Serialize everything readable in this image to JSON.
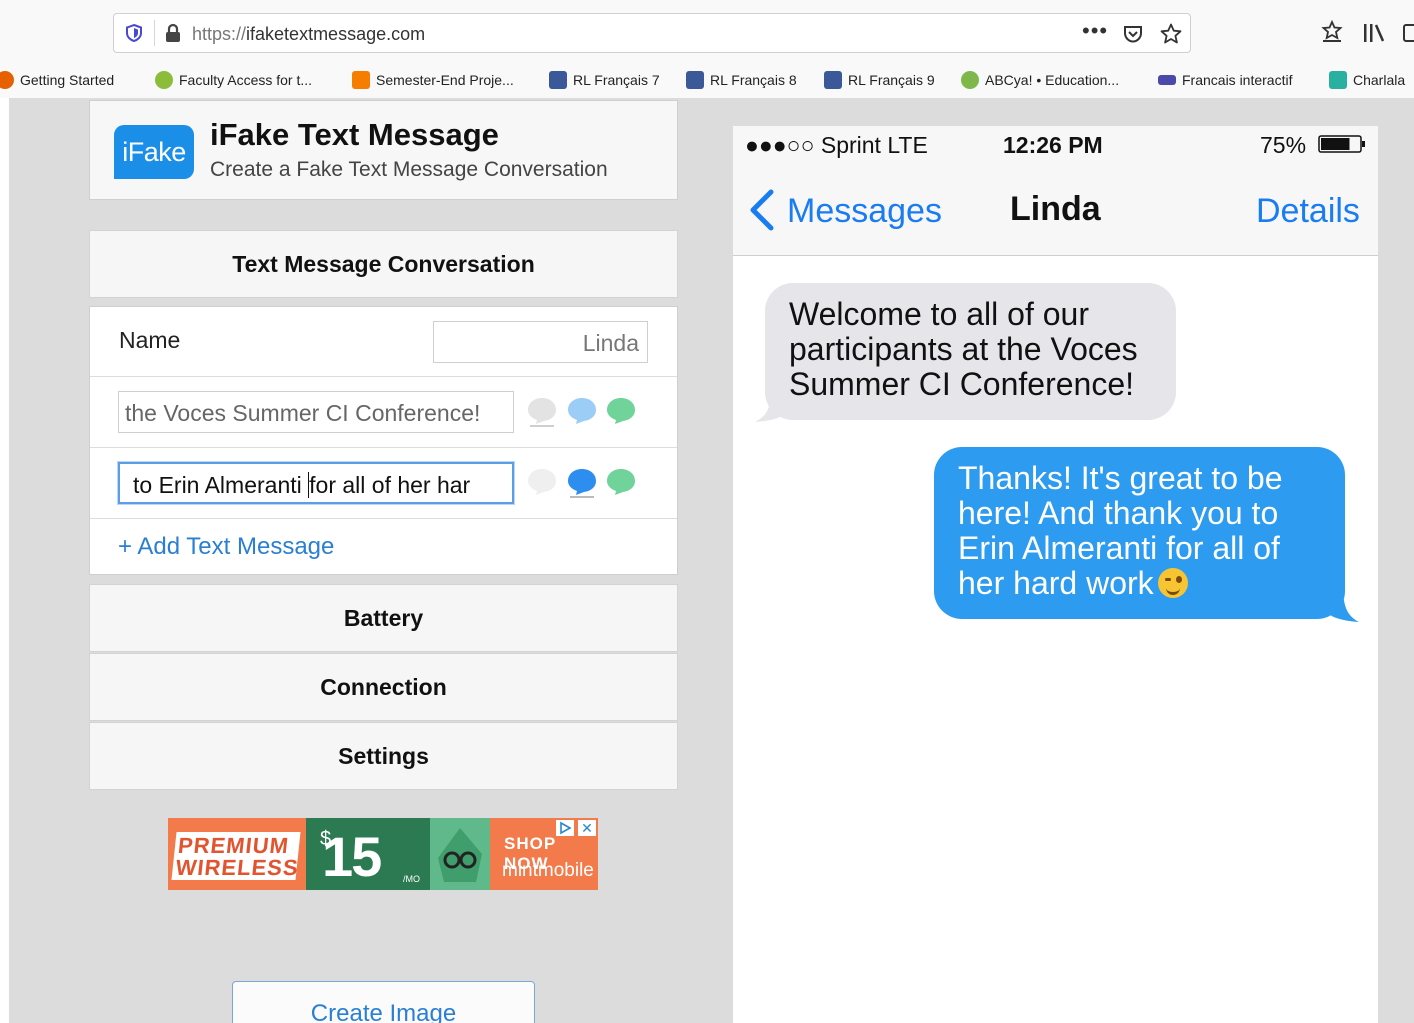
{
  "browser": {
    "url_prefix": "https://",
    "url_host": "ifaketextmessage.com",
    "more_label": "•••",
    "bookmarks": [
      {
        "label": "Getting Started",
        "icon": "firefox-icon",
        "color": "#e66000"
      },
      {
        "label": "Faculty Access for t...",
        "icon": "apple-icon",
        "color": "#8bbd3a"
      },
      {
        "label": "Semester-End Proje...",
        "icon": "blogger-icon",
        "color": "#f57d00"
      },
      {
        "label": "RL Français 7",
        "icon": "classroom-icon",
        "color": "#3b5998"
      },
      {
        "label": "RL Français 8",
        "icon": "classroom-icon",
        "color": "#3b5998"
      },
      {
        "label": "RL Français 9",
        "icon": "classroom-icon",
        "color": "#3b5998"
      },
      {
        "label": "ABCya! • Education...",
        "icon": "abcya-icon",
        "color": "#7fb84a"
      },
      {
        "label": "Francais interactif",
        "icon": "grid-icon",
        "color": "#4a4aa8"
      },
      {
        "label": "Charlala",
        "icon": "charlala-icon",
        "color": "#2ab0a0"
      }
    ]
  },
  "site": {
    "logo_text": "iFake",
    "title": "iFake Text Message",
    "subtitle": "Create a Fake Text Message Conversation"
  },
  "editor": {
    "section_title": "Text Message Conversation",
    "name_label": "Name",
    "name_value": "Linda",
    "messages": [
      {
        "text": "the Voces Summer CI Conference!",
        "sender": "grey"
      },
      {
        "text_before_caret": "to Erin Almeranti ",
        "text_after_caret": "for all of her har",
        "sender": "blue"
      }
    ],
    "add_message_label": "+ Add Text Message",
    "sections": [
      "Battery",
      "Connection",
      "Settings"
    ],
    "create_button": "Create Image"
  },
  "ad": {
    "line1": "PREMIUM",
    "line2": "WIRELESS",
    "dollar": "$",
    "price": "15",
    "per": "/MO",
    "cta": "SHOP NOW",
    "brand": "mintmobile",
    "close": "✕"
  },
  "phone": {
    "signal": "●●●○○ Sprint  LTE",
    "time": "12:26 PM",
    "battery_pct_label": "75%",
    "battery_level": 0.75,
    "back_label": "Messages",
    "contact": "Linda",
    "details_label": "Details",
    "incoming_message": "Welcome to all of our participants at the Voces Summer CI Conference!",
    "outgoing_message": "Thanks! It's great to be here! And thank you to Erin Almeranti for all of her hard work"
  },
  "colors": {
    "ios_blue": "#1a7cf2",
    "sent_bubble": "#2d9bf0",
    "received_bubble": "#e5e5ea",
    "link_blue": "#2a7fd4"
  }
}
